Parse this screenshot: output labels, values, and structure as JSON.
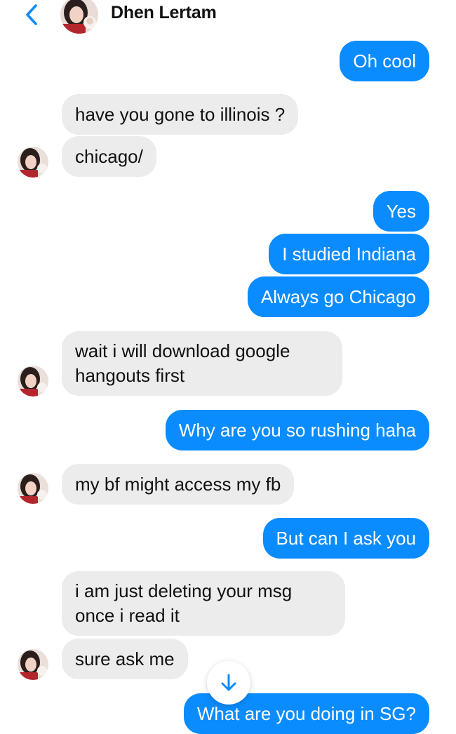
{
  "header": {
    "contact_name": "Dhen Lertam",
    "back_icon": "chevron-left-icon",
    "accent": "#0a8cff"
  },
  "colors": {
    "outgoing_bubble": "#0a8cff",
    "incoming_bubble": "#ececed"
  },
  "messages": [
    {
      "from": "me",
      "text": "Oh cool"
    },
    {
      "from": "them",
      "text": "have you gone to illinois ?"
    },
    {
      "from": "them",
      "text": "chicago/"
    },
    {
      "from": "me",
      "text": "Yes"
    },
    {
      "from": "me",
      "text": "I studied Indiana"
    },
    {
      "from": "me",
      "text": "Always go Chicago"
    },
    {
      "from": "them",
      "text": "wait i will download google hangouts first"
    },
    {
      "from": "me",
      "text": "Why are you so rushing haha"
    },
    {
      "from": "them",
      "text": "my bf might access my fb"
    },
    {
      "from": "me",
      "text": "But can I ask you"
    },
    {
      "from": "them",
      "text": "i am just deleting your msg once i read it"
    },
    {
      "from": "them",
      "text": "sure ask me"
    },
    {
      "from": "me",
      "text": "What are you doing in SG?"
    }
  ],
  "scroll_button_icon": "arrow-down-icon"
}
